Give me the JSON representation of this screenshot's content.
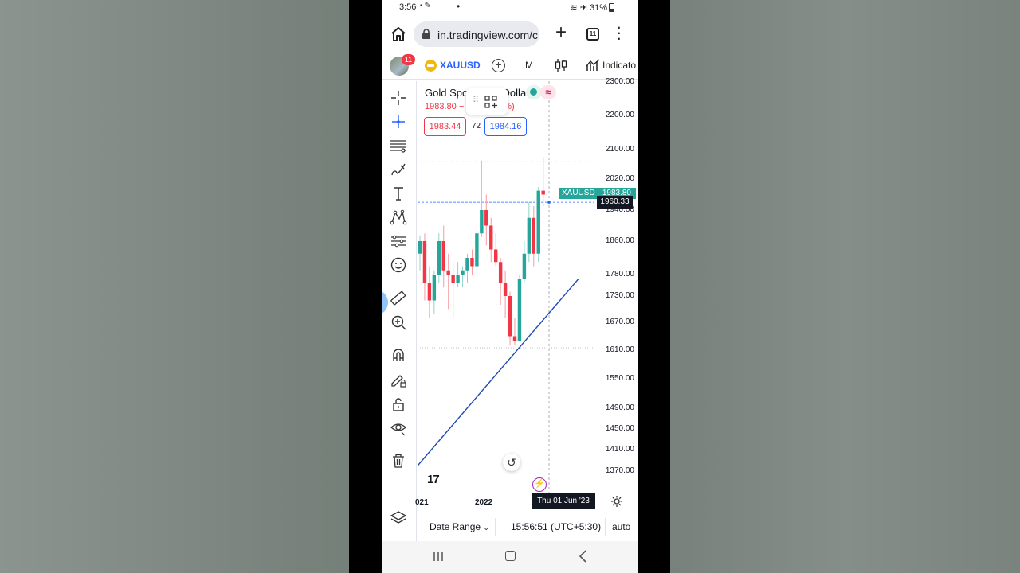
{
  "status_bar": {
    "time": "3:56",
    "battery": "31%"
  },
  "browser": {
    "url": "in.tradingview.com/c",
    "tab_count": "11"
  },
  "tv_header": {
    "notification_count": "11",
    "symbol": "XAUUSD",
    "interval": "M",
    "indicators_label": "Indicato"
  },
  "chart": {
    "legend_title": "Gold Spot / U.S. Dollar",
    "legend_price": "1983.80 −",
    "legend_change_tail": "%)",
    "sell_price": "1983.44",
    "spread": "72",
    "buy_price": "1984.16",
    "last_price_symbol": "XAUUSD",
    "last_price": "1983.80",
    "crosshair_price": "1960.33",
    "crosshair_date": "Thu 01 Jun '23",
    "x_labels": [
      "021",
      "2022"
    ],
    "logo_text": "17"
  },
  "bottom_bar": {
    "date_range": "Date Range",
    "timezone_clock": "15:56:51 (UTC+5:30)",
    "scale_mode": "auto"
  },
  "chart_data": {
    "type": "candlestick",
    "title": "Gold Spot / U.S. Dollar",
    "symbol": "XAUUSD",
    "interval": "M",
    "ylim": [
      1330,
      2310
    ],
    "y_ticks": [
      2300.0,
      2200.0,
      2100.0,
      2020.0,
      1940.0,
      1860.0,
      1780.0,
      1730.0,
      1670.0,
      1610.0,
      1550.0,
      1490.0,
      1450.0,
      1410.0,
      1370.0
    ],
    "x_ticks": [
      "021",
      "2022"
    ],
    "last_price": 1983.8,
    "crosshair_price": 1960.33,
    "crosshair_date": "Thu 01 Jun '23",
    "candles": [
      {
        "o": 1830,
        "h": 1875,
        "l": 1790,
        "c": 1860
      },
      {
        "o": 1860,
        "h": 1880,
        "l": 1720,
        "c": 1760
      },
      {
        "o": 1760,
        "h": 1800,
        "l": 1680,
        "c": 1720
      },
      {
        "o": 1720,
        "h": 1790,
        "l": 1690,
        "c": 1780
      },
      {
        "o": 1780,
        "h": 1880,
        "l": 1760,
        "c": 1860
      },
      {
        "o": 1860,
        "h": 1900,
        "l": 1750,
        "c": 1790
      },
      {
        "o": 1790,
        "h": 1830,
        "l": 1700,
        "c": 1780
      },
      {
        "o": 1780,
        "h": 1810,
        "l": 1680,
        "c": 1760
      },
      {
        "o": 1760,
        "h": 1810,
        "l": 1750,
        "c": 1780
      },
      {
        "o": 1780,
        "h": 1800,
        "l": 1750,
        "c": 1790
      },
      {
        "o": 1790,
        "h": 1830,
        "l": 1760,
        "c": 1820
      },
      {
        "o": 1820,
        "h": 1840,
        "l": 1780,
        "c": 1800
      },
      {
        "o": 1800,
        "h": 1900,
        "l": 1790,
        "c": 1880
      },
      {
        "o": 1880,
        "h": 2070,
        "l": 1870,
        "c": 1940
      },
      {
        "o": 1940,
        "h": 1980,
        "l": 1850,
        "c": 1900
      },
      {
        "o": 1900,
        "h": 1920,
        "l": 1810,
        "c": 1840
      },
      {
        "o": 1840,
        "h": 1880,
        "l": 1800,
        "c": 1810
      },
      {
        "o": 1810,
        "h": 1820,
        "l": 1710,
        "c": 1760
      },
      {
        "o": 1760,
        "h": 1790,
        "l": 1680,
        "c": 1730
      },
      {
        "o": 1730,
        "h": 1740,
        "l": 1620,
        "c": 1640
      },
      {
        "o": 1640,
        "h": 1680,
        "l": 1620,
        "c": 1630
      },
      {
        "o": 1630,
        "h": 1780,
        "l": 1630,
        "c": 1770
      },
      {
        "o": 1770,
        "h": 1860,
        "l": 1760,
        "c": 1830
      },
      {
        "o": 1830,
        "h": 1960,
        "l": 1810,
        "c": 1920
      },
      {
        "o": 1920,
        "h": 1950,
        "l": 1800,
        "c": 1830
      },
      {
        "o": 1830,
        "h": 2000,
        "l": 1810,
        "c": 1990
      },
      {
        "o": 1990,
        "h": 2080,
        "l": 1950,
        "c": 1980
      }
    ],
    "trendline": {
      "from": {
        "x": "2020",
        "y": 1380
      },
      "to": {
        "x": "Aug 2023",
        "y": 1770
      }
    },
    "reference_lines": [
      2067,
      1983.8,
      1960.33,
      1615
    ]
  }
}
